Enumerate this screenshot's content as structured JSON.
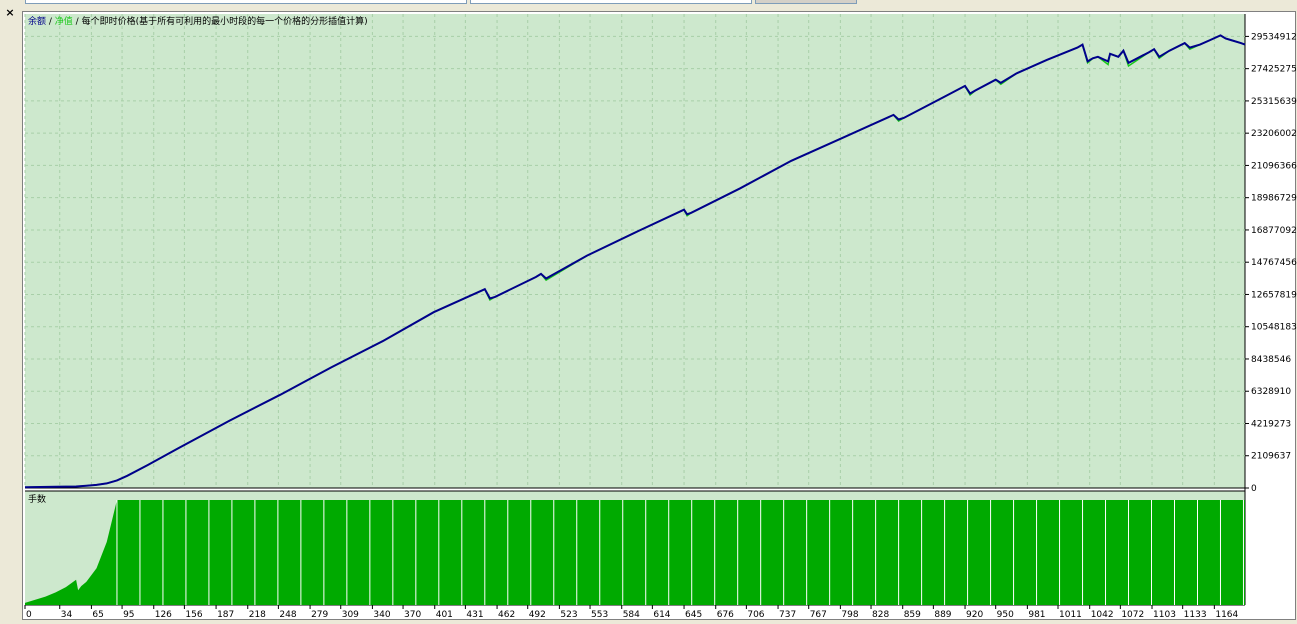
{
  "window": {
    "close_glyph": "×"
  },
  "legend": {
    "balance_label": "余额",
    "sep1": " / ",
    "equity_label": "净值",
    "sep2": " / ",
    "mode_label": "每个即时价格(基于所有可利用的最小时段的每一个价格的分形插值计算)"
  },
  "lots_panel": {
    "title": "手数"
  },
  "colors": {
    "background": "#cde8cd",
    "grid": "#a8cfa8",
    "balance": "#00008b",
    "equity": "#19c819",
    "lots": "#00aa00",
    "lots_divider": "#ffffff"
  },
  "chart_data": [
    {
      "type": "line",
      "title": "",
      "legend": [
        "余额",
        "净值"
      ],
      "y_ticks": [
        0,
        2109637,
        4219273,
        6328910,
        8438546,
        10548183,
        12657819,
        14767456,
        16877092,
        18986729,
        21096366,
        23206002,
        25315639,
        27425275,
        29534912
      ],
      "ylim": [
        0,
        31000000
      ],
      "x_ticks": [
        0,
        34,
        65,
        95,
        126,
        156,
        187,
        218,
        248,
        279,
        309,
        340,
        370,
        401,
        431,
        462,
        492,
        523,
        553,
        584,
        614,
        645,
        676,
        706,
        737,
        767,
        798,
        828,
        859,
        889,
        920,
        950,
        981,
        1011,
        1042,
        1072,
        1103,
        1133,
        1164
      ],
      "xlim": [
        0,
        1194
      ],
      "grid": true,
      "series": [
        {
          "name": "余额",
          "x": [
            0,
            30,
            50,
            60,
            70,
            80,
            90,
            100,
            120,
            150,
            200,
            250,
            300,
            350,
            400,
            450,
            455,
            460,
            500,
            505,
            510,
            550,
            600,
            645,
            648,
            652,
            700,
            750,
            800,
            850,
            855,
            860,
            900,
            920,
            925,
            930,
            950,
            955,
            970,
            1000,
            1030,
            1035,
            1040,
            1045,
            1050,
            1060,
            1062,
            1070,
            1075,
            1080,
            1100,
            1105,
            1110,
            1120,
            1135,
            1140,
            1150,
            1160,
            1170,
            1175,
            1180,
            1190,
            1194
          ],
          "y": [
            50000,
            80000,
            100000,
            150000,
            200000,
            300000,
            500000,
            800000,
            1500000,
            2600000,
            4400000,
            6100000,
            7900000,
            9600000,
            11500000,
            13000000,
            12400000,
            12500000,
            13800000,
            14000000,
            13700000,
            15200000,
            16800000,
            18200000,
            17900000,
            18000000,
            19600000,
            21400000,
            22900000,
            24400000,
            24100000,
            24200000,
            25600000,
            26300000,
            25800000,
            26000000,
            26700000,
            26500000,
            27100000,
            28000000,
            28800000,
            29000000,
            27900000,
            28100000,
            28200000,
            27900000,
            28400000,
            28200000,
            28600000,
            27800000,
            28500000,
            28700000,
            28200000,
            28600000,
            29100000,
            28800000,
            29000000,
            29300000,
            29600000,
            29400000,
            29300000,
            29100000,
            29000000
          ]
        },
        {
          "name": "净值",
          "x": [
            0,
            30,
            50,
            60,
            70,
            80,
            90,
            100,
            120,
            150,
            200,
            250,
            300,
            350,
            400,
            450,
            455,
            460,
            500,
            505,
            510,
            550,
            600,
            645,
            648,
            652,
            700,
            750,
            800,
            850,
            855,
            860,
            900,
            920,
            925,
            930,
            950,
            955,
            970,
            1000,
            1030,
            1035,
            1040,
            1045,
            1050,
            1060,
            1062,
            1070,
            1075,
            1080,
            1100,
            1105,
            1110,
            1120,
            1135,
            1140,
            1150,
            1160,
            1170,
            1175,
            1180,
            1190,
            1194
          ],
          "y": [
            50000,
            80000,
            100000,
            150000,
            200000,
            300000,
            500000,
            800000,
            1500000,
            2600000,
            4400000,
            6100000,
            7900000,
            9600000,
            11500000,
            13000000,
            12300000,
            12500000,
            13800000,
            14000000,
            13600000,
            15200000,
            16800000,
            18200000,
            17800000,
            18000000,
            19600000,
            21400000,
            22900000,
            24400000,
            24000000,
            24200000,
            25600000,
            26300000,
            25700000,
            26000000,
            26700000,
            26400000,
            27100000,
            28000000,
            28800000,
            29000000,
            27800000,
            28100000,
            28200000,
            27700000,
            28400000,
            28200000,
            28600000,
            27600000,
            28500000,
            28700000,
            28100000,
            28600000,
            29100000,
            28700000,
            29000000,
            29300000,
            29600000,
            29400000,
            29300000,
            29100000,
            29000000
          ]
        }
      ]
    },
    {
      "type": "bar",
      "title": "手数",
      "x_ticks": [
        0,
        34,
        65,
        95,
        126,
        156,
        187,
        218,
        248,
        279,
        309,
        340,
        370,
        401,
        431,
        462,
        492,
        523,
        553,
        584,
        614,
        645,
        676,
        706,
        737,
        767,
        798,
        828,
        859,
        889,
        920,
        950,
        981,
        1011,
        1042,
        1072,
        1103,
        1133,
        1164
      ],
      "xlim": [
        0,
        1194
      ],
      "ylim": [
        0,
        1
      ],
      "ramp": {
        "x": [
          0,
          10,
          20,
          30,
          40,
          50,
          52,
          55,
          60,
          70,
          80,
          85,
          90
        ],
        "y": [
          0.02,
          0.05,
          0.08,
          0.12,
          0.17,
          0.24,
          0.14,
          0.18,
          0.22,
          0.35,
          0.6,
          0.8,
          1.0
        ]
      },
      "full_from_x": 90,
      "dividers_every": 22.5
    }
  ]
}
